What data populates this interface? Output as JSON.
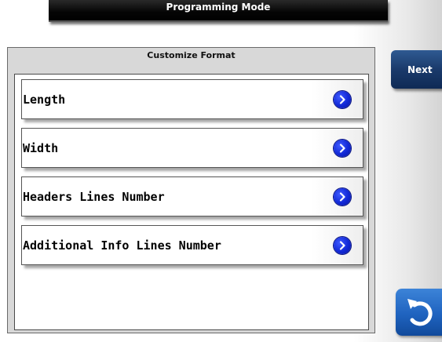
{
  "header": {
    "title": "Programming Mode"
  },
  "panel": {
    "title": "Customize Format",
    "items": [
      {
        "label": "Length",
        "icon": "chevron-right-icon"
      },
      {
        "label": "Width",
        "icon": "chevron-right-icon"
      },
      {
        "label": "Headers Lines Number",
        "icon": "chevron-right-icon"
      },
      {
        "label": "Additional Info Lines Number",
        "icon": "chevron-right-icon"
      }
    ]
  },
  "sidebar": {
    "next_label": "Next",
    "back_icon": "back-arrow-icon"
  },
  "colors": {
    "arrow_blue": "#1128d6",
    "next_button": "#1a3a6b",
    "back_button": "#1f63bf"
  }
}
